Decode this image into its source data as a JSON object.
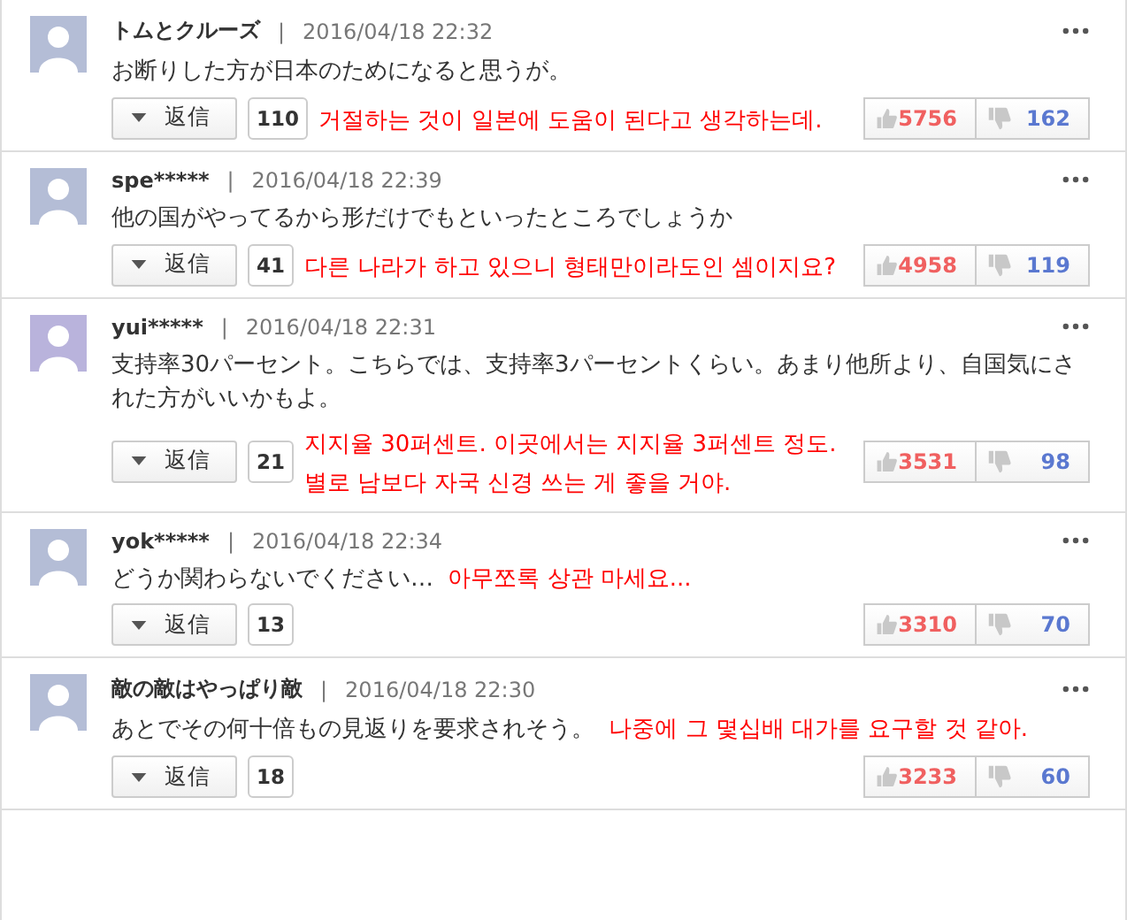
{
  "comments": [
    {
      "user": "トムとクルーズ",
      "separator": "|",
      "date": "2016/04/18 22:32",
      "color": "#b4bdd6",
      "text": "お断りした方が日本のためになると思うが。",
      "translation": "거절하는 것이 일본에 도움이 된다고 생각하는데.",
      "kind": "below",
      "reply_label": "返信",
      "reply_count": "110",
      "likes": "5756",
      "dislikes": "162"
    },
    {
      "user": "spe*****",
      "separator": "|",
      "date": "2016/04/18 22:39",
      "color": "#b4bdd6",
      "text": "他の国がやってるから形だけでもといったところでしょうか",
      "translation": "다른 나라가 하고 있으니 형태만이라도인 셈이지요?",
      "kind": "below",
      "reply_label": "返信",
      "reply_count": "41",
      "likes": "4958",
      "dislikes": "119"
    },
    {
      "user": "yui*****",
      "separator": "|",
      "date": "2016/04/18 22:31",
      "color": "#b9b3dc",
      "text": "支持率30パーセント。こちらでは、支持率3パーセントくらい。あまり他所より、自国気にされた方がいいかもよ。",
      "translation": "지지율 30퍼센트. 이곳에서는 지지율 3퍼센트 정도. 별로 남보다 자국 신경 쓰는 게 좋을 거야.",
      "kind": "below",
      "reply_label": "返信",
      "reply_count": "21",
      "likes": "3531",
      "dislikes": "98"
    },
    {
      "user": "yok*****",
      "separator": "|",
      "date": "2016/04/18 22:34",
      "color": "#b4bdd6",
      "text": "どうか関わらないでください…",
      "translation": "아무쪼록 상관 마세요...",
      "kind": "inline",
      "reply_label": "返信",
      "reply_count": "13",
      "likes": "3310",
      "dislikes": "70"
    },
    {
      "user": "敵の敵はやっぱり敵",
      "separator": "|",
      "date": "2016/04/18 22:30",
      "color": "#b4bdd6",
      "text": "あとでその何十倍もの見返りを要求されそう。",
      "translation": "나중에 그 몇십배 대가를 요구할 것 같아.",
      "kind": "inline",
      "reply_label": "返信",
      "reply_count": "18",
      "likes": "3233",
      "dislikes": "60"
    }
  ]
}
